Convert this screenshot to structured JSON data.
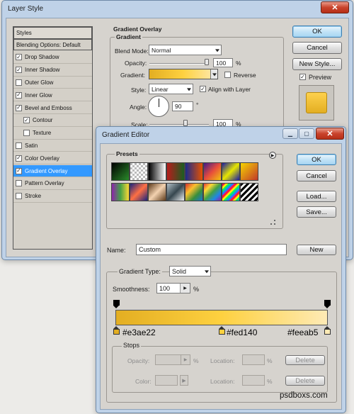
{
  "layer_style": {
    "title": "Layer Style",
    "styles_header": "Styles",
    "items": [
      {
        "label": "Blending Options: Default",
        "checkbox": false,
        "checked": false,
        "indent": false
      },
      {
        "label": "Drop Shadow",
        "checkbox": true,
        "checked": true,
        "indent": false
      },
      {
        "label": "Inner Shadow",
        "checkbox": true,
        "checked": true,
        "indent": false
      },
      {
        "label": "Outer Glow",
        "checkbox": true,
        "checked": false,
        "indent": false
      },
      {
        "label": "Inner Glow",
        "checkbox": true,
        "checked": true,
        "indent": false
      },
      {
        "label": "Bevel and Emboss",
        "checkbox": true,
        "checked": true,
        "indent": false
      },
      {
        "label": "Contour",
        "checkbox": true,
        "checked": true,
        "indent": true
      },
      {
        "label": "Texture",
        "checkbox": true,
        "checked": false,
        "indent": true
      },
      {
        "label": "Satin",
        "checkbox": true,
        "checked": false,
        "indent": false
      },
      {
        "label": "Color Overlay",
        "checkbox": true,
        "checked": true,
        "indent": false
      },
      {
        "label": "Gradient Overlay",
        "checkbox": true,
        "checked": true,
        "indent": false,
        "selected": true
      },
      {
        "label": "Pattern Overlay",
        "checkbox": true,
        "checked": false,
        "indent": false
      },
      {
        "label": "Stroke",
        "checkbox": true,
        "checked": false,
        "indent": false
      }
    ],
    "section_title": "Gradient Overlay",
    "subsection_title": "Gradient",
    "blend_mode_label": "Blend Mode:",
    "blend_mode_value": "Normal",
    "opacity_label": "Opacity:",
    "opacity_value": "100",
    "opacity_unit": "%",
    "gradient_label": "Gradient:",
    "reverse_label": "Reverse",
    "style_label": "Style:",
    "style_value": "Linear",
    "align_label": "Align with Layer",
    "angle_label": "Angle:",
    "angle_value": "90",
    "angle_unit": "°",
    "scale_label": "Scale:",
    "scale_value": "100",
    "scale_unit": "%",
    "ok": "OK",
    "cancel": "Cancel",
    "new_style": "New Style...",
    "preview_label": "Preview"
  },
  "gradient_editor": {
    "title": "Gradient Editor",
    "presets_label": "Presets",
    "ok": "OK",
    "cancel": "Cancel",
    "load": "Load...",
    "save": "Save...",
    "name_label": "Name:",
    "name_value": "Custom",
    "new_button": "New",
    "gradient_type_label": "Gradient Type:",
    "gradient_type_value": "Solid",
    "smoothness_label": "Smoothness:",
    "smoothness_value": "100",
    "smoothness_unit": "%",
    "stop_labels": [
      "#e3ae22",
      "#fed140",
      "#feeab5"
    ],
    "stops_label": "Stops",
    "opacity_label": "Opacity:",
    "opacity_unit": "%",
    "location_label": "Location:",
    "location_unit": "%",
    "color_label": "Color:",
    "delete": "Delete"
  },
  "watermark": "psdboxs.com",
  "colors": {
    "stop1": "#e3ae22",
    "stop2": "#fed140",
    "stop3": "#feeab5",
    "selection": "#3399ff"
  }
}
